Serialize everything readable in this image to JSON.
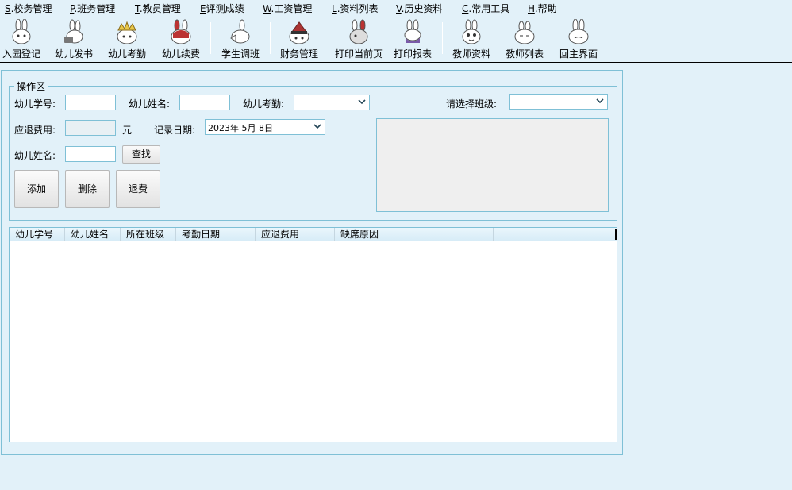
{
  "menu": [
    {
      "accel": "S",
      "label": ".校务管理"
    },
    {
      "accel": "P",
      "label": ".班务管理"
    },
    {
      "accel": "T",
      "label": ".教员管理"
    },
    {
      "accel": "E",
      "label": "评测成绩"
    },
    {
      "accel": "W",
      "label": ".工资管理"
    },
    {
      "accel": "L",
      "label": ".资料列表"
    },
    {
      "accel": "V",
      "label": ".历史资料"
    },
    {
      "accel": "C",
      "label": ".常用工具"
    },
    {
      "accel": "H",
      "label": ".帮助"
    }
  ],
  "toolbar": [
    {
      "label": "入园登记",
      "icon": "rabbit-icon"
    },
    {
      "label": "幼儿发书",
      "icon": "rabbit-books-icon"
    },
    {
      "label": "幼儿考勤",
      "icon": "rabbit-crown-icon"
    },
    {
      "label": "幼儿续费",
      "icon": "rabbit-red-icon"
    },
    {
      "label": "学生调班",
      "icon": "rabbit-hand-icon"
    },
    {
      "label": "财务管理",
      "icon": "rabbit-hat-icon"
    },
    {
      "label": "打印当前页",
      "icon": "rabbit-print-icon"
    },
    {
      "label": "打印报表",
      "icon": "rabbit-purple-icon"
    },
    {
      "label": "教师资料",
      "icon": "rabbit-teacher-icon"
    },
    {
      "label": "教师列表",
      "icon": "rabbit-list-icon"
    },
    {
      "label": "回主界面",
      "icon": "rabbit-home-icon"
    }
  ],
  "form": {
    "group_title": "操作区",
    "student_id_label": "幼儿学号:",
    "student_id_value": "",
    "child_name_label": "幼儿姓名:",
    "child_name_value": "",
    "attendance_label": "幼儿考勤:",
    "attendance_value": "",
    "class_label": "请选择班级:",
    "class_value": "",
    "refund_label": "应退费用:",
    "refund_value": "",
    "refund_unit": "元",
    "record_date_label": "记录日期:",
    "record_date_value": "2023年  5月  8日",
    "search_name_label": "幼儿姓名:",
    "search_name_value": "",
    "find_button": "查找",
    "add_button": "添加",
    "delete_button": "删除",
    "refund_button": "退费"
  },
  "table": {
    "columns": [
      "幼儿学号",
      "幼儿姓名",
      "所在班级",
      "考勤日期",
      "应退费用",
      "缺席原因",
      ""
    ],
    "rows": []
  }
}
